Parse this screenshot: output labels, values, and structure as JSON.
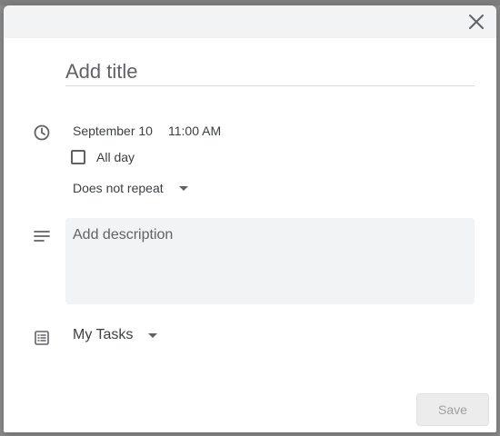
{
  "dialog": {
    "title_placeholder": "Add title",
    "title_value": ""
  },
  "schedule": {
    "date": "September 10",
    "time": "11:00 AM",
    "all_day_label": "All day",
    "all_day_checked": false,
    "repeat": "Does not repeat"
  },
  "description": {
    "placeholder": "Add description",
    "value": ""
  },
  "task_list": {
    "selected": "My Tasks"
  },
  "footer": {
    "save_label": "Save",
    "save_enabled": false
  },
  "icons": {
    "close": "close-icon",
    "time": "clock-icon",
    "description": "notes-icon",
    "task_list": "list-icon"
  },
  "colors": {
    "header_bg": "#f1f3f4",
    "text": "#3c4043",
    "icon": "#5f6368",
    "disabled_button_bg": "#ececec",
    "disabled_button_text": "#a0a0a0"
  }
}
